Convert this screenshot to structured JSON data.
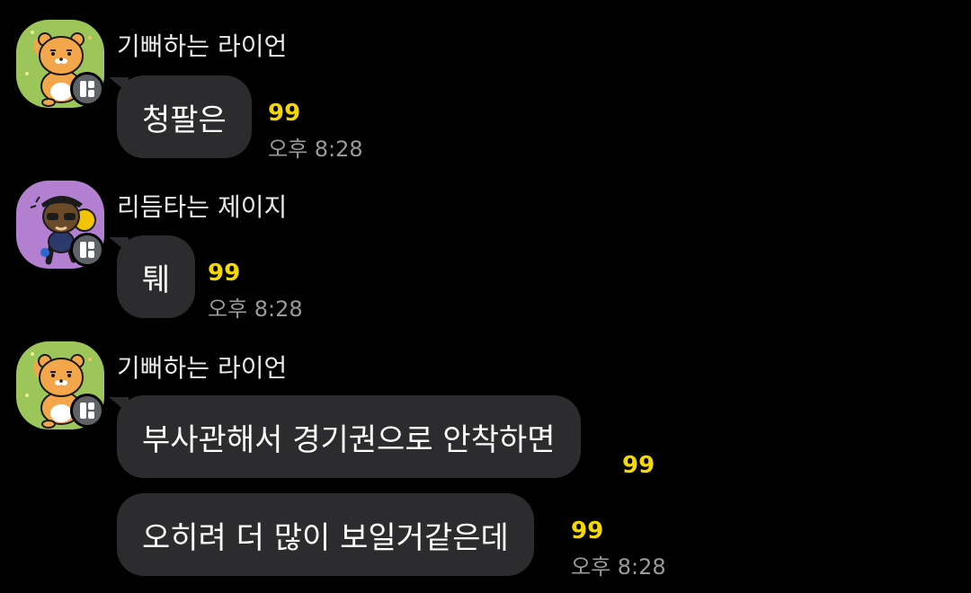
{
  "messages": [
    {
      "sender": "기뻐하는 라이언",
      "avatar": "ryan-cheering",
      "bubbles": [
        {
          "text": "청팔은",
          "unread": "99",
          "time": "오후 8:28"
        }
      ]
    },
    {
      "sender": "리듬타는 제이지",
      "avatar": "jayg-dancing",
      "bubbles": [
        {
          "text": "퉤",
          "unread": "99",
          "time": "오후 8:28"
        }
      ]
    },
    {
      "sender": "기뻐하는 라이언",
      "avatar": "ryan-cheering",
      "bubbles": [
        {
          "text": "부사관해서 경기권으로 안착하면",
          "unread": "99"
        },
        {
          "text": "오히려 더 많이 보일거같은데",
          "unread": "99",
          "time": "오후 8:28"
        }
      ]
    }
  ],
  "colors": {
    "background": "#000000",
    "bubble": "#2c2c2e",
    "unread": "#f5d800",
    "time": "#9a9a9a",
    "ryan_avatar_bg": "#9cc65a",
    "jayg_avatar_bg": "#b27fd1"
  }
}
